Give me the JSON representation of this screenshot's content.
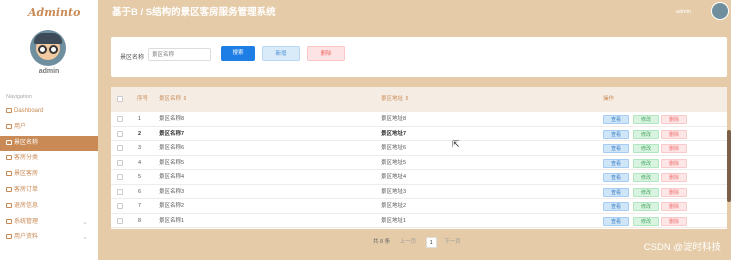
{
  "brand": "Adminto",
  "user": {
    "name": "admin",
    "top_name": "admin"
  },
  "header": {
    "title": "基于B / S结构的景区客房服务管理系统"
  },
  "nav": {
    "title": "Navigation",
    "items": [
      {
        "label": "Dashboard",
        "icon": "home-icon",
        "active": false,
        "expand": false
      },
      {
        "label": "用户",
        "icon": "user-icon",
        "active": false,
        "expand": false
      },
      {
        "label": "景区名称",
        "icon": "list-icon",
        "active": true,
        "expand": false
      },
      {
        "label": "客房分类",
        "icon": "category-icon",
        "active": false,
        "expand": false
      },
      {
        "label": "景区客房",
        "icon": "room-icon",
        "active": false,
        "expand": false
      },
      {
        "label": "客房订单",
        "icon": "order-icon",
        "active": false,
        "expand": false
      },
      {
        "label": "退房信息",
        "icon": "checkout-icon",
        "active": false,
        "expand": false
      },
      {
        "label": "系统管理",
        "icon": "settings-icon",
        "active": false,
        "expand": true
      },
      {
        "label": "用户资料",
        "icon": "profile-icon",
        "active": false,
        "expand": true
      }
    ]
  },
  "search": {
    "label": "景区名称",
    "placeholder": "景区名称",
    "search_btn": "搜索",
    "add_btn": "新增",
    "delete_btn": "删除"
  },
  "table": {
    "columns": {
      "index": "序号",
      "name": "景区名称",
      "address": "景区地址",
      "ops": "操作"
    },
    "sort_glyph": "⇕",
    "rows": [
      {
        "index": "1",
        "name": "景区名称8",
        "address": "景区地址8"
      },
      {
        "index": "2",
        "name": "景区名称7",
        "address": "景区地址7"
      },
      {
        "index": "3",
        "name": "景区名称6",
        "address": "景区地址6"
      },
      {
        "index": "4",
        "name": "景区名称5",
        "address": "景区地址5"
      },
      {
        "index": "5",
        "name": "景区名称4",
        "address": "景区地址4"
      },
      {
        "index": "6",
        "name": "景区名称3",
        "address": "景区地址3"
      },
      {
        "index": "7",
        "name": "景区名称2",
        "address": "景区地址2"
      },
      {
        "index": "8",
        "name": "景区名称1",
        "address": "景区地址1"
      }
    ],
    "ops": {
      "view": "查看",
      "edit": "修改",
      "delete": "删除"
    },
    "highlight_row": 1
  },
  "pagination": {
    "total": "共 8 条",
    "prev": "上一页",
    "page": "1",
    "next": "下一页"
  },
  "watermark": "CSDN @淀时科技",
  "colors": {
    "accent": "#c98a55",
    "background": "#e5cba8",
    "primary": "#1e7ee6"
  }
}
